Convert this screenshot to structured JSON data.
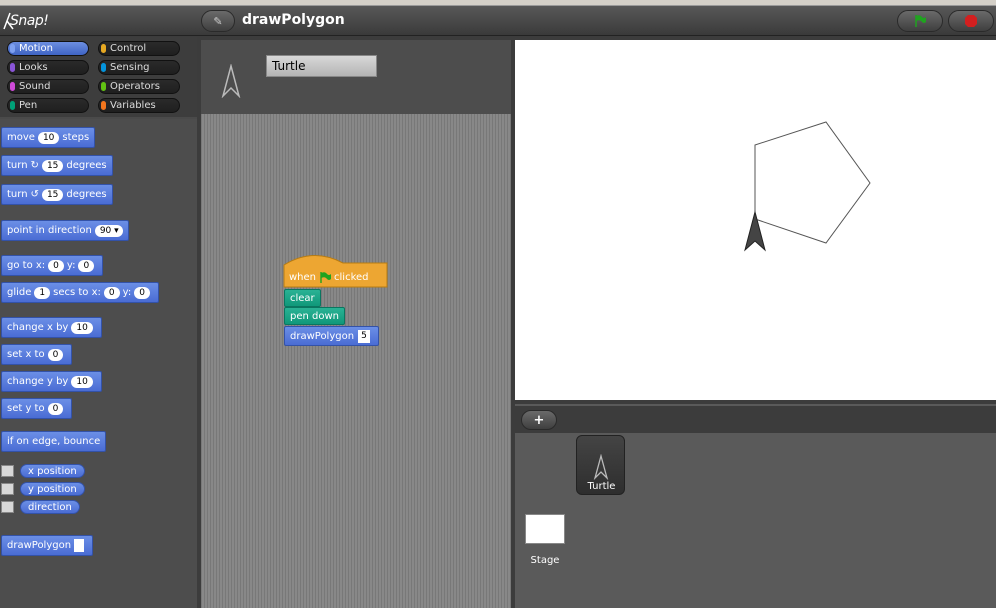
{
  "app": {
    "logo": "Snap!",
    "project_title": "drawPolygon"
  },
  "toolbar": {
    "edit_icon": "pencil-icon",
    "green_flag_color": "#1fa31f",
    "stop_color": "#d21f1f"
  },
  "categories": [
    {
      "label": "Motion",
      "color": "#4a6cd4",
      "selected": true
    },
    {
      "label": "Control",
      "color": "#e6a822"
    },
    {
      "label": "Looks",
      "color": "#8a55d7"
    },
    {
      "label": "Sensing",
      "color": "#0494dc"
    },
    {
      "label": "Sound",
      "color": "#cf4ad9"
    },
    {
      "label": "Operators",
      "color": "#62c213"
    },
    {
      "label": "Pen",
      "color": "#00a178"
    },
    {
      "label": "Variables",
      "color": "#f3761d"
    }
  ],
  "palette": {
    "move": {
      "pre": "move",
      "value": "10",
      "post": "steps"
    },
    "turn_cw": {
      "pre": "turn",
      "value": "15",
      "post": "degrees"
    },
    "turn_ccw": {
      "pre": "turn",
      "value": "15",
      "post": "degrees"
    },
    "point_dir": {
      "pre": "point in direction",
      "value": "90"
    },
    "goto": {
      "pre": "go to x:",
      "x": "0",
      "ylabel": "y:",
      "y": "0"
    },
    "glide": {
      "pre": "glide",
      "secs": "1",
      "mid": "secs to x:",
      "x": "0",
      "ylabel": "y:",
      "y": "0"
    },
    "change_x": {
      "pre": "change x by",
      "value": "10"
    },
    "set_x": {
      "pre": "set x to",
      "value": "0"
    },
    "change_y": {
      "pre": "change y by",
      "value": "10"
    },
    "set_y": {
      "pre": "set y to",
      "value": "0"
    },
    "bounce": {
      "label": "if on edge, bounce"
    },
    "x_position": "x position",
    "y_position": "y position",
    "direction": "direction",
    "custom": {
      "label": "drawPolygon"
    }
  },
  "sprite": {
    "name": "Turtle"
  },
  "script": {
    "hat": {
      "pre": "when",
      "post": "clicked"
    },
    "clear": "clear",
    "pen_down": "pen down",
    "draw": {
      "label": "drawPolygon",
      "value": "5"
    }
  },
  "corral": {
    "sprite_label": "Turtle",
    "stage_label": "Stage",
    "add_icon": "plus-icon"
  }
}
